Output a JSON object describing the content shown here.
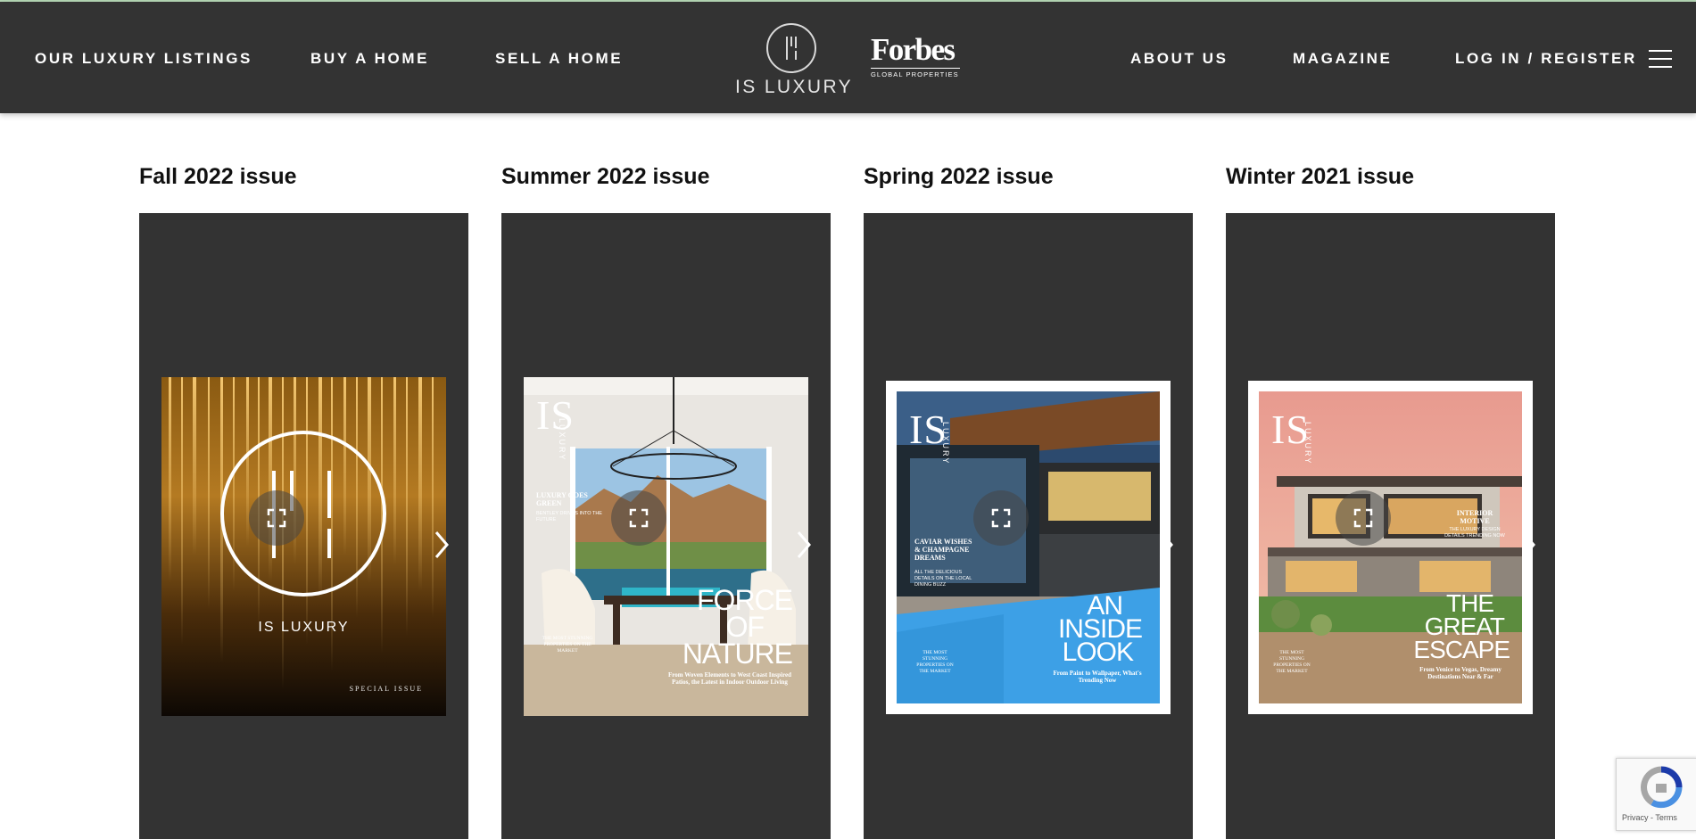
{
  "nav": {
    "left": [
      "OUR LUXURY LISTINGS",
      "BUY A HOME",
      "SELL A HOME"
    ],
    "right": [
      "ABOUT US",
      "MAGAZINE",
      "LOG IN / REGISTER"
    ],
    "logo_text": "IS LUXURY",
    "forbes_word": "Forbes",
    "forbes_sub": "GLOBAL PROPERTIES"
  },
  "issues": [
    {
      "title": "Fall 2022 issue",
      "cover": {
        "brand": "IS LUXURY",
        "footer": "SPECIAL ISSUE"
      }
    },
    {
      "title": "Summer 2022 issue",
      "cover": {
        "mast": "IS",
        "mast_side": "LUXURY",
        "kicker": "LUXURY GOES GREEN",
        "kicker_sub": "BENTLEY DRIVES INTO THE FUTURE",
        "headline": [
          "FORCE",
          "OF",
          "NATURE"
        ],
        "deck": "From Woven Elements to West Coast Inspired Patios, the Latest in Indoor Outdoor Living",
        "side": "THE MOST STUNNING PROPERTIES ON THE MARKET"
      }
    },
    {
      "title": "Spring 2022 issue",
      "cover": {
        "mast": "IS",
        "mast_side": "LUXURY",
        "kicker": "CAVIAR WISHES & CHAMPAGNE DREAMS",
        "kicker_sub": "ALL THE DELICIOUS DETAILS ON THE LOCAL DINING BUZZ",
        "headline": [
          "AN",
          "INSIDE",
          "LOOK"
        ],
        "deck": "From Paint to Wallpaper, What's Trending Now",
        "side": "THE MOST STUNNING PROPERTIES ON THE MARKET"
      }
    },
    {
      "title": "Winter 2021 issue",
      "cover": {
        "mast": "IS",
        "mast_side": "LUXURY",
        "kicker": "INTERIOR MOTIVE",
        "kicker_sub": "THE LUXURY DESIGN DETAILS TRENDING NOW",
        "headline": [
          "THE",
          "GREAT",
          "ESCAPE"
        ],
        "deck": "From Venice to Vegas, Dreamy Destinations Near & Far",
        "side": "THE MOST STUNNING PROPERTIES ON THE MARKET"
      }
    }
  ],
  "recaptcha": {
    "privacy": "Privacy",
    "terms": "Terms"
  },
  "colors": {
    "header": "#333333",
    "panel": "#333333",
    "title": "#111111"
  }
}
